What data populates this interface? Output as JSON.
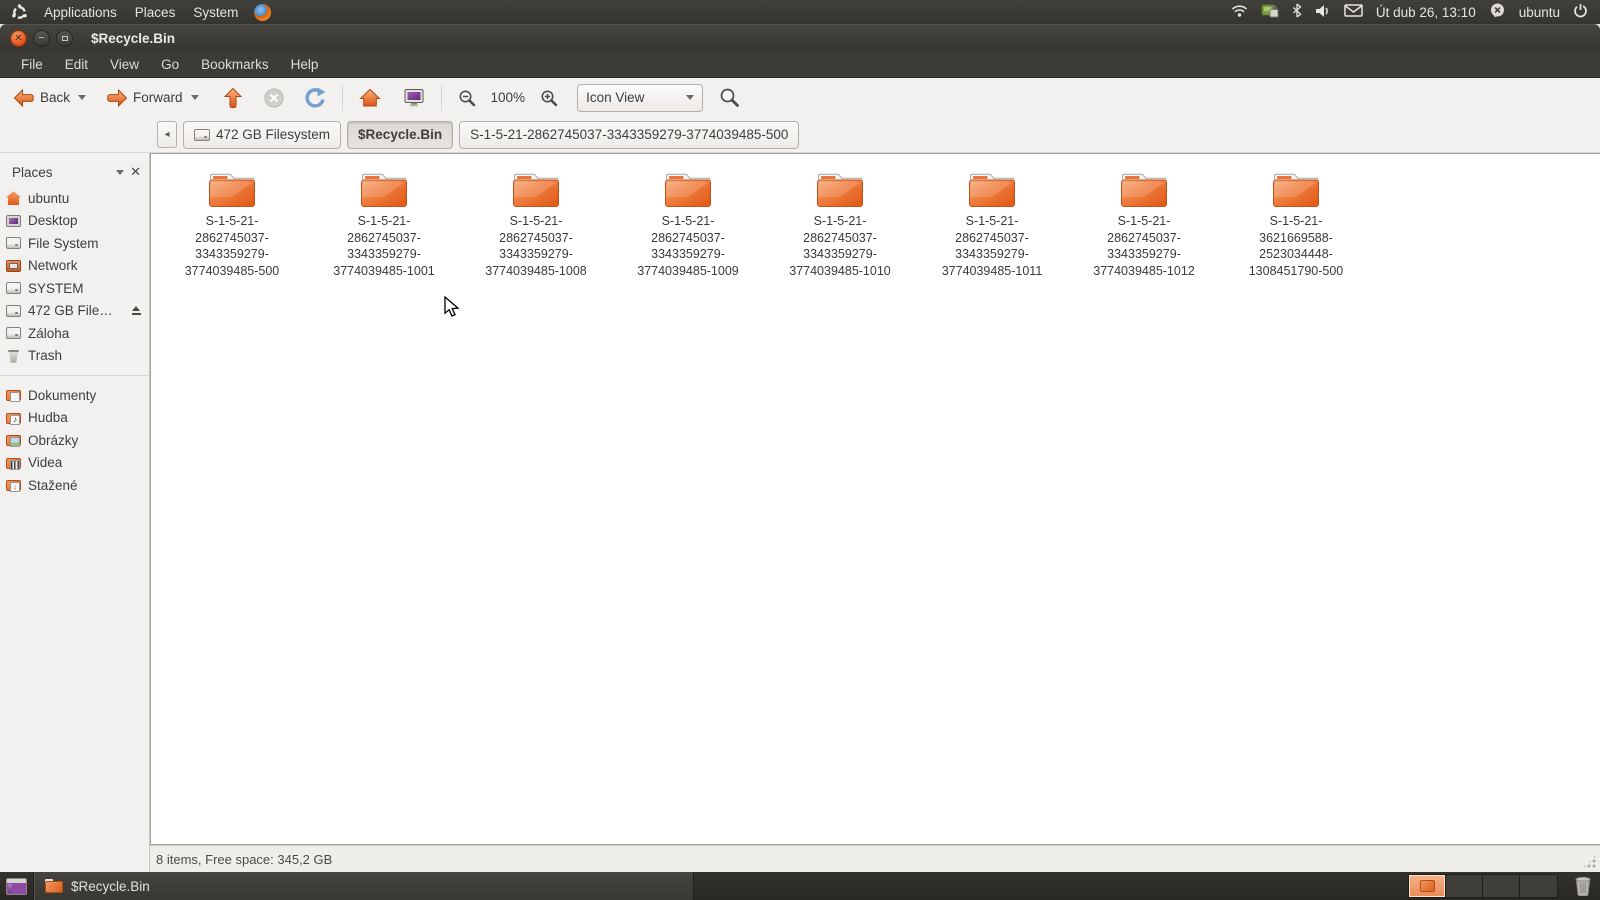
{
  "top_panel": {
    "menus": [
      "Applications",
      "Places",
      "System"
    ],
    "clock": "Út dub 26, 13:10",
    "username": "ubuntu"
  },
  "window": {
    "title": "$Recycle.Bin",
    "menubar": [
      "File",
      "Edit",
      "View",
      "Go",
      "Bookmarks",
      "Help"
    ],
    "toolbar": {
      "back_label": "Back",
      "forward_label": "Forward",
      "zoom_level": "100%",
      "view_mode": "Icon View"
    },
    "pathbar": [
      {
        "label": "472 GB Filesystem",
        "icon": "drive"
      },
      {
        "label": "$Recycle.Bin",
        "active": true
      },
      {
        "label": "S-1-5-21-2862745037-3343359279-3774039485-500"
      }
    ],
    "sidebar": {
      "header": "Places",
      "items": [
        {
          "label": "ubuntu",
          "icon": "home"
        },
        {
          "label": "Desktop",
          "icon": "desktop"
        },
        {
          "label": "File System",
          "icon": "drive"
        },
        {
          "label": "Network",
          "icon": "network"
        },
        {
          "label": "SYSTEM",
          "icon": "drive"
        },
        {
          "label": "472 GB File…",
          "icon": "drive",
          "eject": true
        },
        {
          "label": "Záloha",
          "icon": "drive"
        },
        {
          "label": "Trash",
          "icon": "trash"
        },
        {
          "separator": true
        },
        {
          "label": "Dokumenty",
          "icon": "folder-documents"
        },
        {
          "label": "Hudba",
          "icon": "folder-music"
        },
        {
          "label": "Obrázky",
          "icon": "folder-pictures"
        },
        {
          "label": "Videa",
          "icon": "folder-videos"
        },
        {
          "label": "Stažené",
          "icon": "folder-downloads"
        }
      ]
    },
    "folders": [
      {
        "name": "S-1-5-21-2862745037-3343359279-3774039485-500"
      },
      {
        "name": "S-1-5-21-2862745037-3343359279-3774039485-1001"
      },
      {
        "name": "S-1-5-21-2862745037-3343359279-3774039485-1008"
      },
      {
        "name": "S-1-5-21-2862745037-3343359279-3774039485-1009"
      },
      {
        "name": "S-1-5-21-2862745037-3343359279-3774039485-1010"
      },
      {
        "name": "S-1-5-21-2862745037-3343359279-3774039485-1011"
      },
      {
        "name": "S-1-5-21-2862745037-3343359279-3774039485-1012"
      },
      {
        "name": "S-1-5-21-3621669588-2523034448-1308451790-500"
      }
    ],
    "statusbar_text": "8 items, Free space: 345,2 GB"
  },
  "taskbar": {
    "window_button_label": "$Recycle.Bin",
    "workspaces": [
      {
        "active": true
      },
      {},
      {},
      {}
    ]
  },
  "colors": {
    "panel_dark": "#3C3B37",
    "accent_orange": "#DD5C18",
    "selection_orange": "#F2A173",
    "toolbar_bg": "#F2F1EF",
    "pane_white": "#FFFFFF"
  }
}
